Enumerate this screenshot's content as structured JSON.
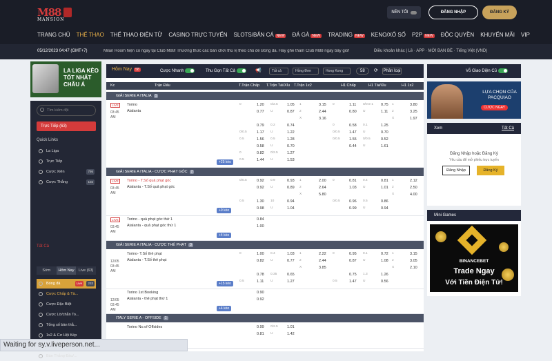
{
  "header": {
    "logo": {
      "main": "M88",
      "sub": "MANSION"
    },
    "dark_mode_label": "NỀN TỐI",
    "login": "ĐĂNG NHẬP",
    "register": "ĐĂNG KÝ",
    "nav": [
      {
        "label": "TRANG CHỦ",
        "active": false,
        "new": ""
      },
      {
        "label": "THỂ THAO",
        "active": true,
        "new": ""
      },
      {
        "label": "THỂ THAO ĐIỆN TỬ",
        "active": false,
        "new": ""
      },
      {
        "label": "CASINO TRỰC TUYẾN",
        "active": false,
        "new": ""
      },
      {
        "label": "SLOTS/BẮN CÁ",
        "active": false,
        "new": "NEW"
      },
      {
        "label": "ĐÁ GÀ",
        "active": false,
        "new": "NEW"
      },
      {
        "label": "TRADING",
        "active": false,
        "new": "NEW"
      },
      {
        "label": "KENO/XỔ SỐ",
        "active": false,
        "new": ""
      },
      {
        "label": "P2P",
        "active": false,
        "new": "NEW"
      },
      {
        "label": "ĐỘC QUYỀN",
        "active": false,
        "new": ""
      },
      {
        "label": "KHUYẾN MÃI",
        "active": false,
        "new": ""
      },
      {
        "label": "VIP",
        "active": false,
        "new": ""
      }
    ]
  },
  "ticker": {
    "time": "05/12/2023 04:47 (GMT+7)",
    "message": "Milan Room hiện có ngay tại Club M88! Thưởng thức các bàn chơi thú vị theo chủ đề Bóng đá. Hãy ghé thăm Club M88 ngay bây giờ!",
    "right": "Điều khoản khác | Lề  ·  APP  ·  MỜI BẠN BÈ  ·  Tiếng Việt (VND)"
  },
  "left": {
    "banner": "LA LIGA KÈO TỐT NHẤT CHÂU Á",
    "search_placeholder": "Tìm kiếm đội",
    "live_label": "Trực Tiếp (63)",
    "quick_links_title": "Quick Links",
    "quick_links": [
      {
        "label": "La Liga",
        "count": ""
      },
      {
        "label": "Trực Tiếp",
        "count": ""
      },
      {
        "label": "Cược Xiên",
        "count": "795"
      },
      {
        "label": "Cược Thắng",
        "count": "102"
      }
    ],
    "all_title": "Tất Cả",
    "tabs": [
      "Sớm",
      "Hôm Nay",
      "Live (63)"
    ],
    "sports": [
      {
        "label": "Bóng đá",
        "count": "233",
        "live": "Live"
      },
      {
        "label": "Cược Chấp & Tà...",
        "count": "",
        "live": ""
      },
      {
        "label": "Cược Đặc Biệt",
        "count": "",
        "live": ""
      },
      {
        "label": "Cược Lờ/chẵn To...",
        "count": "",
        "live": ""
      },
      {
        "label": "Tổng số bàn thắ...",
        "count": "",
        "live": ""
      },
      {
        "label": "1x2 & Cơ Hội Kép",
        "count": "",
        "live": ""
      },
      {
        "label": "Hiệp 1 / Toàn Trận",
        "count": "",
        "live": ""
      },
      {
        "label": "Bàn Thắng Đầu/...",
        "count": "",
        "live": ""
      }
    ]
  },
  "main": {
    "today": "Hôm Nay",
    "today_count": "58",
    "fast_bet": "Cược Nhanh",
    "collapse": "Thu Gọn Tất Cả",
    "filters": [
      "Tất cả",
      "Hồng Đơn",
      "Hong Kong"
    ],
    "count_label": "58",
    "sort": "Phân loại",
    "columns": [
      "Kc",
      "Trận Đấu",
      "T.Trận Chấp",
      "T.Trận Tài/Xỉu",
      "T.Trận 1x2",
      "H1 Chấp",
      "H1 Tài/Xỉu",
      "H1 1x2"
    ],
    "groups": [
      {
        "title": "GIẢI SERIE A ITALIA",
        "n": "1",
        "matches": [
          {
            "time": "03:45 AM",
            "home": "Torino",
            "away": "Atalanta",
            "more": "+25 kèo",
            "lines": [
              [
                "0",
                "1.20",
                "0/2.5",
                "1.05",
                "1",
                "3.15",
                "0",
                "1.11",
                "0/0.5-1",
                "0.75",
                "1",
                "3.80"
              ],
              [
                "",
                "0.77",
                "U",
                "0.87",
                "2",
                "2.44",
                "",
                "0.80",
                "U",
                "1.11",
                "2",
                "3.25"
              ],
              [
                "",
                "",
                "",
                "",
                "X",
                "3.16",
                "",
                "",
                "",
                "",
                "X",
                "1.97"
              ],
              [
                "",
                "0.79",
                "0.2",
                "0.74",
                "",
                "",
                "0",
                "0.58",
                "0.1",
                "1.25",
                "",
                ""
              ],
              [
                "0/0.5",
                "1.17",
                "U",
                "1.22",
                "",
                "",
                "0/0.5",
                "1.47",
                "U",
                "0.70",
                "",
                ""
              ],
              [
                "0.5",
                "1.56",
                "0.5",
                "1.28",
                "",
                "",
                "0/0.5",
                "1.55",
                "0/0.5",
                "0.52",
                "",
                ""
              ],
              [
                "",
                "0.58",
                "U",
                "0.70",
                "",
                "",
                "",
                "0.44",
                "U",
                "1.61",
                "",
                ""
              ],
              [
                "0",
                "0.82",
                "0/2.5",
                "1.27",
                "",
                "",
                "",
                "",
                "",
                "",
                "",
                ""
              ],
              [
                "0.5",
                "1.44",
                "U",
                "1.53",
                "",
                "",
                "",
                "",
                "",
                "",
                "",
                ""
              ]
            ]
          }
        ]
      },
      {
        "title": "GIẢI SERIE A ITALIA - CƯỢC PHẠT GÓC",
        "n": "2",
        "matches": [
          {
            "time": "03:45 AM",
            "home": "Torino - T.Số quả phạt góc",
            "away": "Atalanta - T.Số quả phạt góc",
            "more": "+9 kèo",
            "lines": [
              [
                "0/0.5",
                "0.92",
                "0.9",
                "0.93",
                "1",
                "2.00",
                "0",
                "0.81",
                "0.4",
                "0.81",
                "1",
                "2.12"
              ],
              [
                "",
                "0.92",
                "U",
                "0.89",
                "2",
                "2.64",
                "",
                "1.03",
                "U",
                "1.01",
                "2",
                "2.50"
              ],
              [
                "",
                "",
                "",
                "",
                "X",
                "5.80",
                "",
                "",
                "",
                "",
                "X",
                "4.00"
              ],
              [
                "0.5",
                "1.30",
                "10",
                "0.94",
                "",
                "",
                "0/0.5",
                "0.96",
                "0.5",
                "0.86",
                "",
                ""
              ],
              [
                "",
                "0.98",
                "U",
                "1.04",
                "",
                "",
                "",
                "0.99",
                "U",
                "0.94",
                "",
                ""
              ]
            ]
          },
          {
            "time": "03:45 AM",
            "home": "Torino - quả phạt góc thứ 1",
            "away": "Atalanta - quả phạt góc thứ 1",
            "more": "+4 kèo",
            "lines": [
              [
                "",
                "0.84",
                "",
                "",
                "",
                "",
                "",
                "",
                "",
                "",
                "",
                ""
              ],
              [
                "",
                "1.00",
                "",
                "",
                "",
                "",
                "",
                "",
                "",
                "",
                "",
                ""
              ]
            ]
          }
        ]
      },
      {
        "title": "GIẢI SERIE A ITALIA - CƯỢC THẺ PHẠT",
        "n": "3",
        "matches": [
          {
            "time": "12/05 03:45 AM",
            "home": "Torino- T.Số thẻ phạt",
            "away": "Atalanta - T.Số thẻ phạt",
            "more": "+15 kèo",
            "lines": [
              [
                "0",
                "1.00",
                "0.4",
                "1.03",
                "1",
                "2.22",
                "0",
                "0.95",
                "0.1",
                "0.72",
                "1",
                "3.15"
              ],
              [
                "",
                "0.82",
                "U",
                "0.77",
                "2",
                "2.44",
                "",
                "0.87",
                "U",
                "1.08",
                "2",
                "3.05"
              ],
              [
                "",
                "",
                "",
                "",
                "X",
                "3.85",
                "",
                "",
                "",
                "",
                "X",
                "2.10"
              ],
              [
                "",
                "0.78",
                "0.35",
                "0.65",
                "",
                "",
                "",
                "0.75",
                "1.3",
                "1.26",
                "",
                ""
              ],
              [
                "0.5",
                "1.11",
                "U",
                "1.27",
                "",
                "",
                "0.5",
                "1.47",
                "U",
                "0.56",
                "",
                ""
              ]
            ]
          },
          {
            "time": "12/05 03:45 AM",
            "home": "Torino 1st Booking",
            "away": "Atalanta - thẻ phạt thứ 1",
            "more": "+4 kèo",
            "lines": [
              [
                "",
                "0.90",
                "",
                "",
                "",
                "",
                "",
                "",
                "",
                "",
                "",
                ""
              ],
              [
                "",
                "0.92",
                "",
                "",
                "",
                "",
                "",
                "",
                "",
                "",
                "",
                ""
              ]
            ]
          }
        ]
      },
      {
        "title": "ITALY SERIE A - OFFSIDE",
        "n": "1",
        "matches": [
          {
            "time": "",
            "home": "Torino No.of Offsides",
            "away": "",
            "more": "",
            "lines": [
              [
                "",
                "0.99",
                "0/2.5",
                "1.01",
                "",
                "",
                "",
                "",
                "",
                "",
                "",
                ""
              ],
              [
                "",
                "0.81",
                "U",
                "1.42",
                "",
                "",
                "",
                "",
                "",
                "",
                "",
                ""
              ]
            ]
          }
        ]
      }
    ]
  },
  "right": {
    "interface": "Vỗ Giao Diện Cũ",
    "ad_text": "LỰA CHỌN CỦA PACQUIAO",
    "ad_cta": "CƯỢC NGAY",
    "bet_title": "Xem",
    "bet_link": "Tất Cả",
    "bet_msg": "Đăng Nhập hoặc Đăng Ký",
    "bet_sub": "Yêu cầu để mở phiếu trực tuyến",
    "bet_login": "Đăng Nhập",
    "bet_register": "Đăng Ký",
    "mini_title": "Mini Games",
    "binance": {
      "name": "BINANCEBET",
      "line1": "Trade Ngay",
      "line2": "Với Tiền Điện Tử!"
    }
  },
  "status": "Waiting for sy.v.liveperson.net..."
}
